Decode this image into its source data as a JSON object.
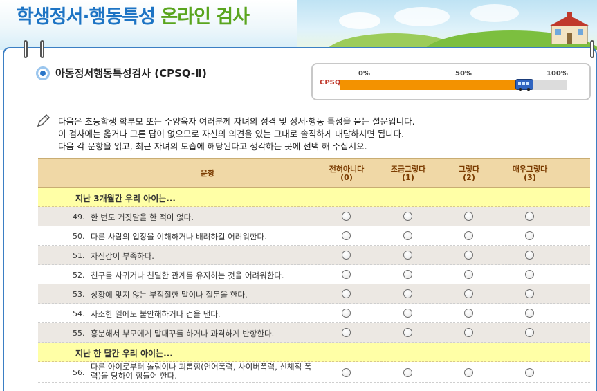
{
  "header": {
    "title_part1": "학생정서·행동특성",
    "title_part2": "온라인 검사"
  },
  "section": {
    "title": "아동정서행동특성검사 (CPSQ-Ⅱ)"
  },
  "progress": {
    "label": "CPSQⅡ",
    "tick_0": "0%",
    "tick_50": "50%",
    "tick_100": "100%",
    "value_fraction": 0.78
  },
  "instructions": [
    "다음은 초등학생 학부모 또는 주양육자 여러분께 자녀의 성격 및 정서·행동 특성을 묻는 설문입니다.",
    "이 검사에는 옳거나 그른 답이 없으므로 자신의 의견을 있는 그대로 솔직하게 대답하시면 됩니다.",
    "다음 각 문항을 읽고, 최근 자녀의 모습에 해당된다고 생각하는 곳에 선택 해 주십시오."
  ],
  "table": {
    "header_question": "문항",
    "options": [
      {
        "label": "전혀아니다",
        "score": "(0)"
      },
      {
        "label": "조금그렇다",
        "score": "(1)"
      },
      {
        "label": "그렇다",
        "score": "(2)"
      },
      {
        "label": "매우그렇다",
        "score": "(3)"
      }
    ],
    "group1_label": "지난 3개월간 우리 아이는...",
    "group2_label": "지난 한 달간 우리 아이는...",
    "questions": [
      {
        "num": "49.",
        "text": "한 번도 거짓말을 한 적이 없다."
      },
      {
        "num": "50.",
        "text": "다른 사람의 입장을 이해하거나 배려하길 어려워한다."
      },
      {
        "num": "51.",
        "text": "자신감이 부족하다."
      },
      {
        "num": "52.",
        "text": "친구를 사귀거나 친밀한 관계를 유지하는 것을 어려워한다."
      },
      {
        "num": "53.",
        "text": "상황에 맞지 않는 부적절한 말이나 질문을 한다."
      },
      {
        "num": "54.",
        "text": "사소한 일에도 불안해하거나 겁을 낸다."
      },
      {
        "num": "55.",
        "text": "흥분해서 부모에게 말대꾸를 하거나 과격하게 반항한다."
      },
      {
        "num": "56.",
        "text": "다른 아이로부터 놀림이나 괴롭힘(언어폭력, 사이버폭력, 신체적 폭력)을 당하여 힘들어 한다."
      }
    ]
  },
  "colors": {
    "title_blue": "#1d74c4",
    "title_green": "#5aa51e",
    "progress_fill": "#f39200",
    "header_bg": "#f0d8a6",
    "group_bg": "#ffffa6"
  }
}
